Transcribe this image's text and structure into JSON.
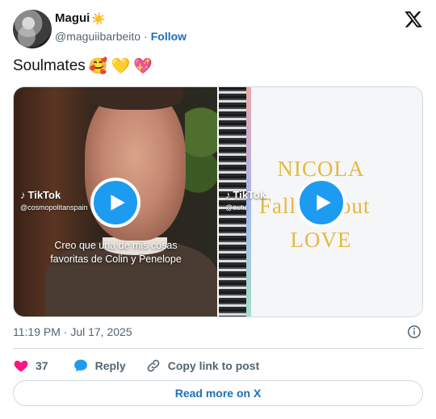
{
  "author": {
    "name": "Magui",
    "name_emoji": "☀️",
    "handle": "@maguiibarbeito",
    "separator": "·",
    "follow_label": "Follow"
  },
  "tweet": {
    "text": "Soulmates",
    "emojis": [
      "🥰",
      "💛",
      "💖"
    ]
  },
  "media": [
    {
      "platform": "TikTok",
      "username": "@cosmopolitanspain",
      "caption_line1": "Creo que una de mis cosas",
      "caption_line2": "favoritas de Colin y Penelope"
    },
    {
      "platform": "TikTok",
      "username": "@autu",
      "title_line1": "NICOLA",
      "title_line2a": "Fall",
      "title_line2b": "out",
      "title_line3": "LOVE"
    }
  ],
  "timestamp": "11:19 PM · Jul 17, 2025",
  "actions": {
    "likes": "37",
    "reply_label": "Reply",
    "copy_label": "Copy link to post"
  },
  "read_more_label": "Read more on X",
  "colors": {
    "accent": "#1d9bf0",
    "link": "#1d6fb8",
    "heart": "#f91880",
    "muted": "#536471",
    "border": "#cfd9de",
    "title_gold": "#e7b83d"
  }
}
